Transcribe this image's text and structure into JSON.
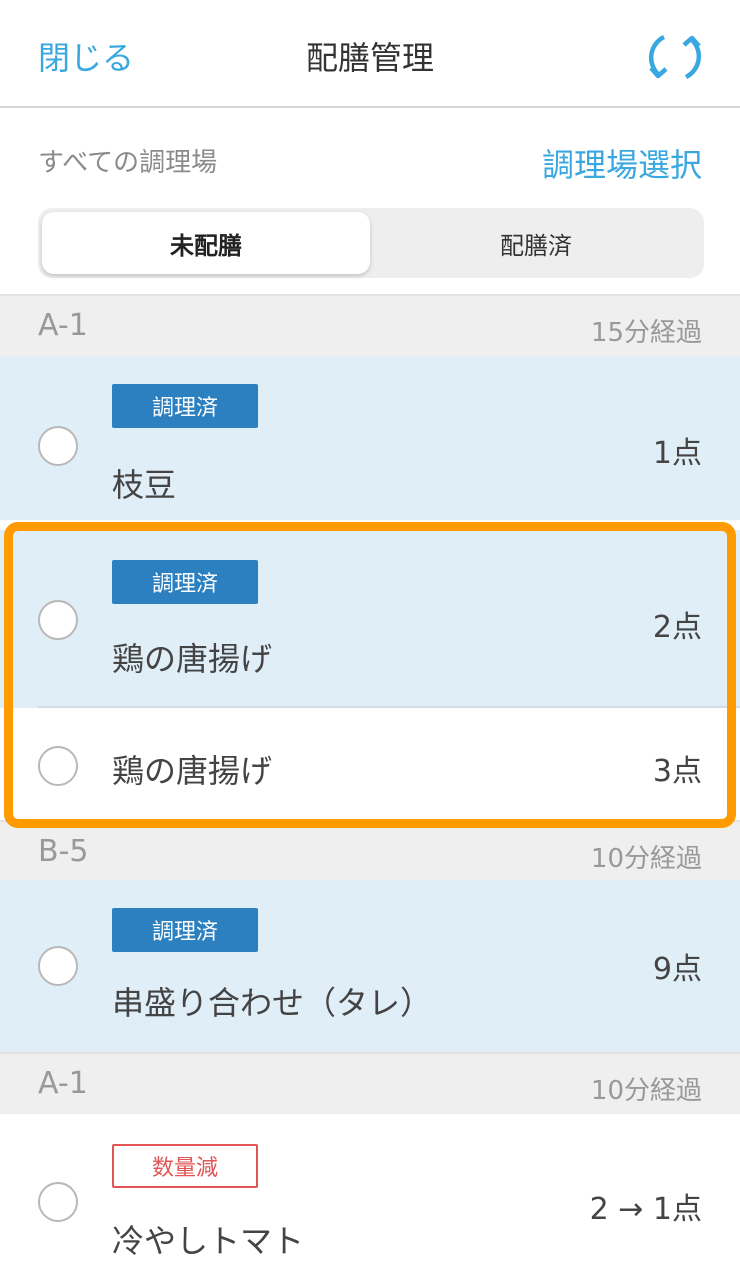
{
  "header": {
    "close_label": "閉じる",
    "title": "配膳管理",
    "refresh_icon": "refresh-icon"
  },
  "filter": {
    "all_kitchens": "すべての調理場",
    "select_kitchen": "調理場選択"
  },
  "tabs": [
    {
      "label": "未配膳",
      "selected": true
    },
    {
      "label": "配膳済",
      "selected": false
    }
  ],
  "colors": {
    "accent": "#3aa8e0",
    "cooked_tag": "#2c80c0",
    "reduced_tag": "#e05555",
    "row_highlight": "#e0eef8",
    "selection_outline": "#ff9a00"
  },
  "groups": [
    {
      "table": "A-1",
      "elapsed": "15分経過",
      "items": [
        {
          "tag": "調理済",
          "name": "枝豆",
          "qty": "1点"
        }
      ]
    },
    {
      "items": [
        {
          "tag": "調理済",
          "name": "鶏の唐揚げ",
          "qty": "2点"
        },
        {
          "name": "鶏の唐揚げ",
          "qty": "3点"
        }
      ]
    },
    {
      "table": "B-5",
      "elapsed": "10分経過",
      "items": [
        {
          "tag": "調理済",
          "name": "串盛り合わせ（タレ）",
          "qty": "9点"
        }
      ]
    },
    {
      "table": "A-1",
      "elapsed": "10分経過",
      "items": [
        {
          "tag": "数量減",
          "name": "冷やしトマト",
          "qty": "2 → 1点"
        }
      ]
    }
  ]
}
